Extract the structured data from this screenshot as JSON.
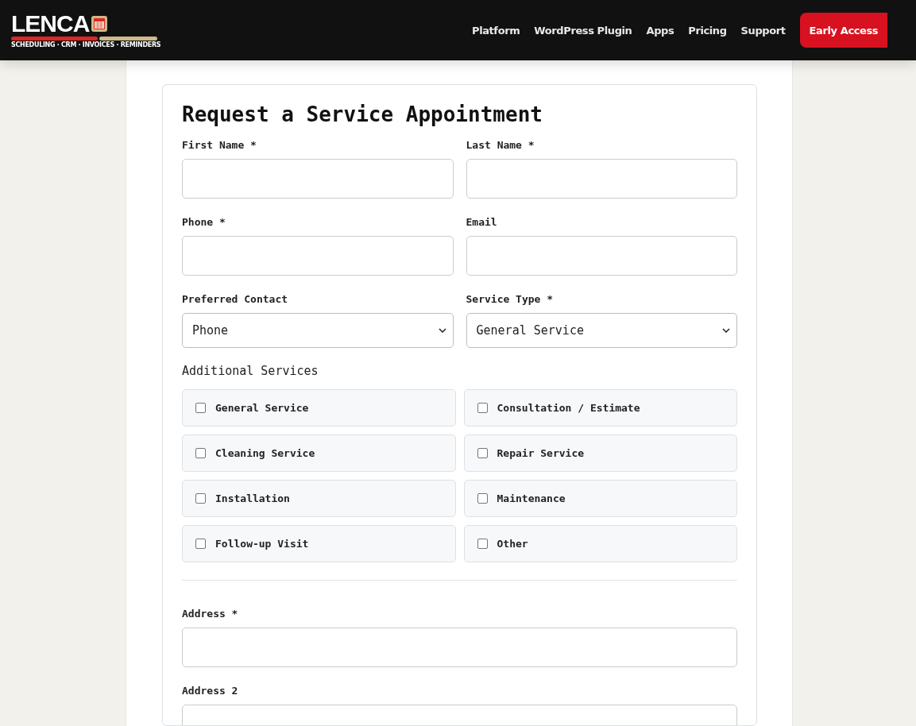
{
  "header": {
    "logo": {
      "wordmark": "LENCA",
      "tagline": "SCHEDULING · CRM · INVOICES · REMINDERS"
    },
    "nav": [
      "Platform",
      "WordPress Plugin",
      "Apps",
      "Pricing",
      "Support"
    ],
    "cta": "Early Access"
  },
  "form": {
    "title": "Request a Service Appointment",
    "rows": [
      [
        {
          "kind": "input",
          "label": "First Name *"
        },
        {
          "kind": "input",
          "label": "Last Name *"
        }
      ],
      [
        {
          "kind": "input",
          "label": "Phone *"
        },
        {
          "kind": "input",
          "label": "Email"
        }
      ],
      [
        {
          "kind": "select",
          "label": "Preferred Contact",
          "value": "Phone"
        },
        {
          "kind": "select",
          "label": "Service Type *",
          "value": "General Service"
        }
      ]
    ],
    "services_label": "Additional Services",
    "services": [
      {
        "label": "General Service",
        "checked": false
      },
      {
        "label": "Consultation / Estimate",
        "checked": false
      },
      {
        "label": "Cleaning Service",
        "checked": false
      },
      {
        "label": "Repair Service",
        "checked": false
      },
      {
        "label": "Installation",
        "checked": false
      },
      {
        "label": "Maintenance",
        "checked": false
      },
      {
        "label": "Follow-up Visit",
        "checked": false
      },
      {
        "label": "Other",
        "checked": false
      }
    ],
    "address_fields": [
      {
        "label": "Address *"
      },
      {
        "label": "Address 2"
      }
    ]
  }
}
